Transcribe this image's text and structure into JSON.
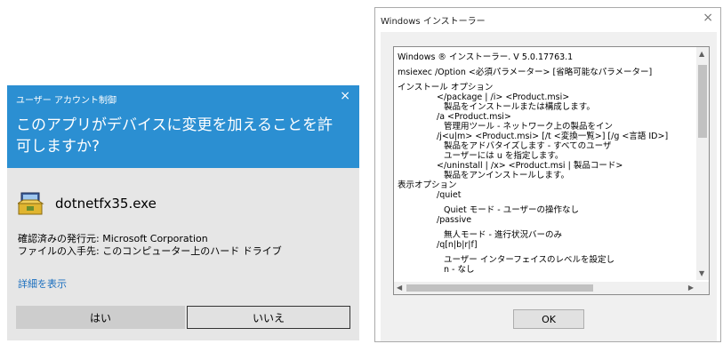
{
  "uac": {
    "caption": "ユーザー アカウント制御",
    "close_glyph": "×",
    "question": "このアプリがデバイスに変更を加えることを許可しますか?",
    "app_name": "dotnetfx35.exe",
    "publisher": "確認済みの発行元: Microsoft Corporation",
    "origin": "ファイルの入手先: このコンピューター上のハード ドライブ",
    "details_link": "詳細を表示",
    "yes_label": "はい",
    "no_label": "いいえ",
    "header_color": "#2b8fd2"
  },
  "installer": {
    "title": "Windows インストーラー",
    "close_glyph": "×",
    "ok_label": "OK",
    "lines": {
      "l1": "Windows ® インストーラー. V 5.0.17763.1",
      "l2": "msiexec /Option <必須パラメーター> [省略可能なパラメーター]",
      "l3": "インストール オプション",
      "l4": "</package | /i> <Product.msi>",
      "l5": "製品をインストールまたは構成します。",
      "l6": "/a <Product.msi>",
      "l7": "管理用ツール - ネットワーク上の製品をイン",
      "l8": "/j<u|m> <Product.msi> [/t <変換一覧>] [/g <言語 ID>]",
      "l9": "製品をアドバタイズします - すべてのユーザ",
      "l10": "ユーザーには u を指定します。",
      "l11": "</uninstall | /x> <Product.msi | 製品コード>",
      "l12": "製品をアンインストールします。",
      "l13": "表示オプション",
      "l14": "/quiet",
      "l15": "Quiet モード - ユーザーの操作なし",
      "l16": "/passive",
      "l17": "無人モード - 進行状況バーのみ",
      "l18": "/q[n|b|r|f]",
      "l19": "ユーザー インターフェイスのレベルを設定し",
      "l20": "n - なし"
    },
    "scroll_up": "▲",
    "scroll_down": "▼",
    "scroll_left": "◀",
    "scroll_right": "▶"
  }
}
